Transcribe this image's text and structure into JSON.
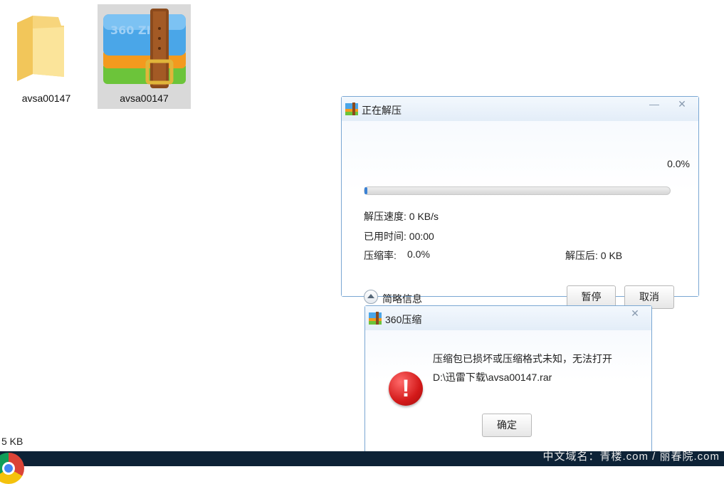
{
  "desktop": {
    "folder_label": "avsa00147",
    "archive_label": "avsa00147",
    "archive_icon_text": "360 ZIP"
  },
  "status_bar": {
    "size_text": "5 KB"
  },
  "watermark": "中文域名：青楼.com / 丽春院.com",
  "extract_dialog": {
    "title": "正在解压",
    "percent": "0.0%",
    "progress": 0.0,
    "speed": "解压速度: 0 KB/s",
    "elapsed": "已用时间: 00:00",
    "ratio_label": "压缩率:",
    "ratio_value": "0.0%",
    "after_size": "解压后: 0 KB",
    "brief_info": "简略信息",
    "pause_button": "暂停",
    "cancel_button": "取消"
  },
  "error_dialog": {
    "title": "360压缩",
    "message_line1": "压缩包已损坏或压缩格式未知，无法打开",
    "message_line2": "D:\\迅雷下载\\avsa00147.rar",
    "ok_button": "确定"
  },
  "icons": {
    "folder": "folder-icon",
    "archive": "zip-archive-icon",
    "error": "error-icon",
    "minimize": "minimize-icon",
    "close": "close-icon"
  },
  "colors": {
    "accent": "#3b82d4",
    "error_red": "#d31919",
    "taskbar": "#0d2236"
  }
}
